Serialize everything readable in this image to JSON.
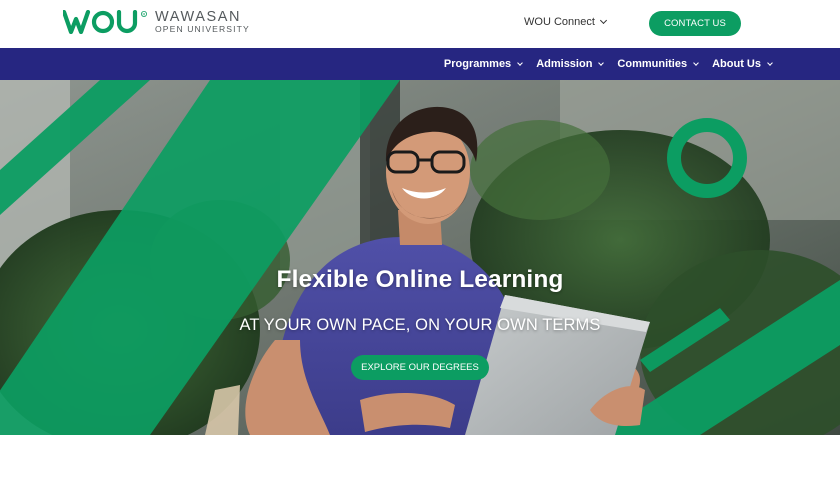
{
  "header": {
    "logo": {
      "mark_text": "WOU",
      "line1": "WAWASAN",
      "line2": "OPEN UNIVERSITY"
    },
    "connect_label": "WOU Connect",
    "contact_label": "CONTACT US"
  },
  "nav": {
    "items": [
      {
        "label": "Programmes"
      },
      {
        "label": "Admission"
      },
      {
        "label": "Communities"
      },
      {
        "label": "About Us"
      }
    ]
  },
  "hero": {
    "title": "Flexible Online Learning",
    "subtitle": "AT YOUR OWN PACE, ON YOUR OWN TERMS",
    "cta_label": "EXPLORE OUR DEGREES"
  },
  "colors": {
    "brand_green": "#0c9d62",
    "nav_blue": "#262681",
    "logo_gray": "#555a5d"
  }
}
